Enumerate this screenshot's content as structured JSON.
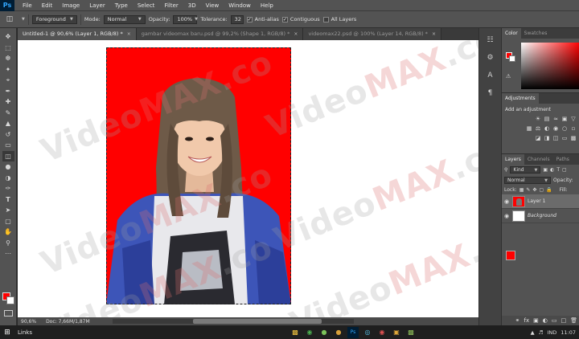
{
  "app": {
    "logo": "Ps"
  },
  "menu": [
    "File",
    "Edit",
    "Image",
    "Layer",
    "Type",
    "Select",
    "Filter",
    "3D",
    "View",
    "Window",
    "Help"
  ],
  "options": {
    "tool_icon": "paint-bucket-icon",
    "source": "Foreground",
    "mode_label": "Mode:",
    "mode_value": "Normal",
    "opacity_label": "Opacity:",
    "opacity_value": "100%",
    "tolerance_label": "Tolerance:",
    "tolerance_value": "32",
    "antialias_label": "Anti-alias",
    "contiguous_label": "Contiguous",
    "all_layers_label": "All Layers"
  },
  "tabs": [
    {
      "label": "Untitled-1 @ 90,6% (Layer 1, RGB/8) *",
      "close": "×"
    },
    {
      "label": "gambar videomax baru.psd @ 99,2% (Shape 1, RGB/8) *",
      "close": "×"
    },
    {
      "label": "videomax22.psd @ 100% (Layer 14, RGB/8) *",
      "close": "×"
    }
  ],
  "watermark": {
    "prefix": "Video",
    "accent": "MAX",
    "suffix": ".co"
  },
  "status": {
    "zoom": "90,6%",
    "doc": "Doc: 7,66M/1,87M"
  },
  "panels": {
    "color_tabs": [
      "Color",
      "Swatches"
    ],
    "adjustments_tab": "Adjustments",
    "adjustments_title": "Add an adjustment",
    "layers_tabs": [
      "Layers",
      "Channels",
      "Paths"
    ],
    "kind_label": "Kind",
    "blend_mode": "Normal",
    "opacity_label": "Opacity:",
    "lock_label": "Lock:",
    "fill_label": "Fill:",
    "layers": [
      {
        "name": "Layer 1",
        "active": true
      },
      {
        "name": "Background",
        "active": false
      }
    ]
  },
  "taskbar": {
    "links": "Links",
    "lang": "IND",
    "time": "11:07"
  },
  "colors": {
    "foreground": "#ff0000",
    "background": "#ffffff",
    "accent": "#31a8ff"
  }
}
